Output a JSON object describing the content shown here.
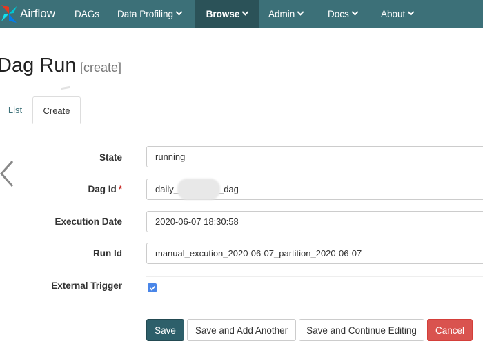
{
  "navbar": {
    "brand": "Airflow",
    "items": [
      {
        "label": "DAGs"
      },
      {
        "label": "Data Profiling"
      },
      {
        "label": "Browse"
      },
      {
        "label": "Admin"
      },
      {
        "label": "Docs"
      },
      {
        "label": "About"
      }
    ],
    "colors": {
      "bar": "#3c7078",
      "active": "#2b5258"
    }
  },
  "page": {
    "title": "Dag Run",
    "subtitle": "[create]"
  },
  "tabs": [
    {
      "label": "List"
    },
    {
      "label": "Create"
    }
  ],
  "form": {
    "state": {
      "label": "State",
      "value": "running"
    },
    "dag_id": {
      "label": "Dag Id",
      "required_mark": "*",
      "value_prefix": "daily_",
      "value_suffix": "_dag"
    },
    "execution_date": {
      "label": "Execution Date",
      "value": "2020-06-07 18:30:58"
    },
    "run_id": {
      "label": "Run Id",
      "value": "manual_excution_2020-06-07_partition_2020-06-07"
    },
    "external_trigger": {
      "label": "External Trigger",
      "checked": true
    }
  },
  "buttons": {
    "save": "Save",
    "save_add": "Save and Add Another",
    "save_continue": "Save and Continue Editing",
    "cancel": "Cancel"
  }
}
